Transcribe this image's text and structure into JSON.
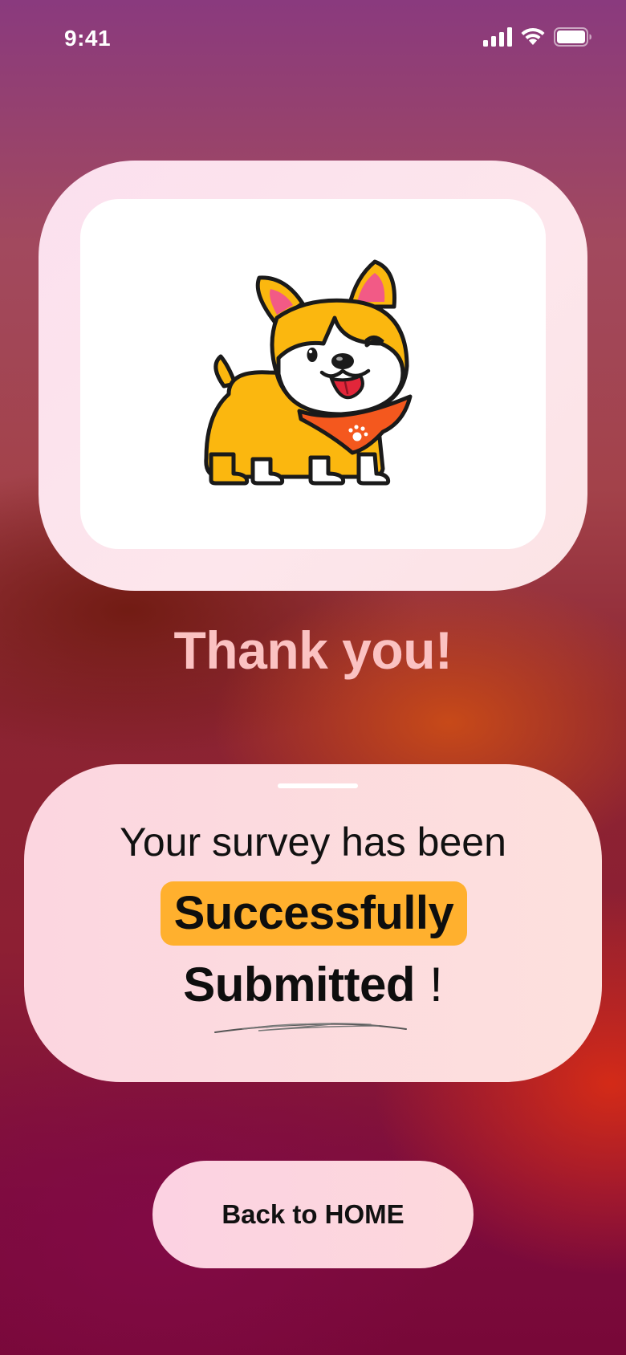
{
  "status_bar": {
    "time": "9:41",
    "icons": [
      "signal-icon",
      "wifi-icon",
      "battery-icon"
    ]
  },
  "hero": {
    "illustration": "corgi-illustration"
  },
  "title": "Thank you!",
  "message": {
    "line1": "Your survey has been",
    "highlight": "Successfully",
    "line3": "Submitted",
    "punctuation": "!"
  },
  "button": {
    "label": "Back to HOME"
  },
  "colors": {
    "title": "#fbc2c2",
    "highlight": "#ffb02e",
    "card": "#fde0e6",
    "corgi_body": "#fbb70f",
    "bandana": "#f4581e"
  }
}
